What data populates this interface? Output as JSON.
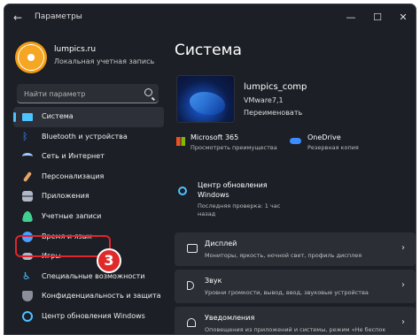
{
  "window": {
    "title": "Параметры"
  },
  "user": {
    "name": "lumpics.ru",
    "account": "Локальная учетная запись"
  },
  "search": {
    "placeholder": "Найти параметр"
  },
  "nav": {
    "items": [
      {
        "label": "Система",
        "icon": "monitor-icon",
        "color": "#4cc2ff",
        "active": true
      },
      {
        "label": "Bluetooth и устройства",
        "icon": "bluetooth-icon",
        "color": "#3b8cff"
      },
      {
        "label": "Сеть и Интернет",
        "icon": "wifi-icon",
        "color": "#9ecbff"
      },
      {
        "label": "Персонализация",
        "icon": "brush-icon",
        "color": "#e5a46c"
      },
      {
        "label": "Приложения",
        "icon": "apps-icon",
        "color": "#b0b8c8"
      },
      {
        "label": "Учетные записи",
        "icon": "user-icon",
        "color": "#3ecf8e"
      },
      {
        "label": "Время и язык",
        "icon": "globe-clock-icon",
        "color": "#4a9fff"
      },
      {
        "label": "Игры",
        "icon": "gamepad-icon",
        "color": "#b0b8c8"
      },
      {
        "label": "Специальные возможности",
        "icon": "accessibility-icon",
        "color": "#4cc2ff"
      },
      {
        "label": "Конфиденциальность и защита",
        "icon": "shield-icon",
        "color": "#8a8f99"
      },
      {
        "label": "Центр обновления Windows",
        "icon": "update-icon",
        "color": "#4cc2ff"
      }
    ]
  },
  "annotation": {
    "step": "3"
  },
  "main": {
    "title": "Система",
    "device": {
      "name": "lumpics_comp",
      "model": "VMware7,1",
      "rename": "Переименовать"
    },
    "tiles": {
      "ms365": {
        "title": "Microsoft 365",
        "sub": "Просмотреть преимущества"
      },
      "onedrive": {
        "title": "OneDrive",
        "sub": "Резервная копия"
      },
      "update": {
        "title_line1": "Центр обновления",
        "title_line2": "Windows",
        "sub_line1": "Последняя проверка: 1 час",
        "sub_line2": "назад"
      }
    },
    "cards": [
      {
        "title": "Дисплей",
        "sub": "Мониторы, яркость, ночной свет, профиль дисплея",
        "icon": "display-icon"
      },
      {
        "title": "Звук",
        "sub": "Уровни громкости, вывод, ввод, звуковые устройства",
        "icon": "sound-icon"
      },
      {
        "title": "Уведомления",
        "sub": "Оповещения из приложений и системы, режим «Не беспок",
        "icon": "bell-icon"
      }
    ]
  },
  "colors": {
    "accent": "#4cc2ff",
    "highlight": "#e0252e"
  }
}
